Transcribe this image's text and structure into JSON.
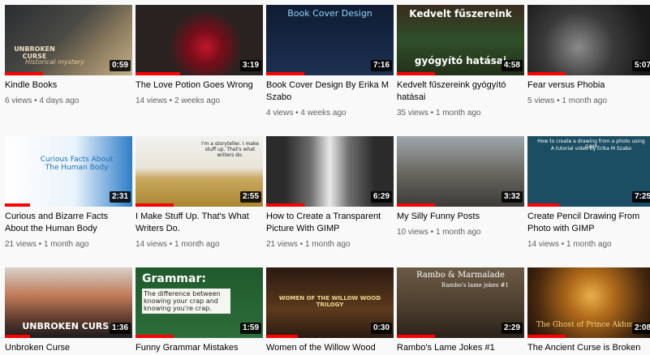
{
  "videos": [
    {
      "title": "Kindle Books",
      "views": "6 views",
      "age": "4 days ago",
      "duration": "0:59",
      "progress": 0.3,
      "caption": "UNBROKEN CURSE",
      "caption2": "Historical mystery"
    },
    {
      "title": "The Love Potion Goes Wrong",
      "views": "14 views",
      "age": "2 weeks ago",
      "duration": "3:19",
      "progress": 0.35
    },
    {
      "title": "Book Cover Design By Erika M Szabo",
      "views": "4 views",
      "age": "4 weeks ago",
      "duration": "7:16",
      "progress": 0.3,
      "caption": "Book Cover Design"
    },
    {
      "title": "Kedvelt fűszereink gyógyító hatásai",
      "views": "35 views",
      "age": "1 month ago",
      "duration": "4:58",
      "progress": 0.3,
      "caption": "Kedvelt fűszereink",
      "caption2": "gyógyító hatásai"
    },
    {
      "title": "Fear versus Phobia",
      "views": "5 views",
      "age": "1 month ago",
      "duration": "5:07",
      "progress": 0.3
    },
    {
      "title": "Curious and Bizarre Facts About the Human Body",
      "views": "21 views",
      "age": "1 month ago",
      "duration": "2:31",
      "progress": 0.2,
      "caption": "Curious Facts About The Human Body"
    },
    {
      "title": "I Make Stuff Up. That's What Writers Do.",
      "views": "14 views",
      "age": "1 month ago",
      "duration": "2:55",
      "progress": 0.3,
      "caption": "I'm a storyteller. I make stuff up. That's what writers do."
    },
    {
      "title": "How to Create a Transparent Picture With GIMP",
      "views": "21 views",
      "age": "1 month ago",
      "duration": "6:29",
      "progress": 0.3
    },
    {
      "title": "My Silly Funny Posts",
      "views": "10 views",
      "age": "1 month ago",
      "duration": "3:32",
      "progress": 0.3
    },
    {
      "title": "Create Pencil Drawing From Photo with GIMP",
      "views": "14 views",
      "age": "1 month ago",
      "duration": "7:25",
      "progress": 0.25,
      "caption": "How to create a drawing from a photo using GIMP",
      "caption2": "A tutorial video by Erika M Szabo"
    },
    {
      "title": "Unbroken Curse",
      "views": "",
      "age": "",
      "duration": "1:36",
      "progress": 0.2,
      "caption": "UNBROKEN CURSE"
    },
    {
      "title": "Funny Grammar Mistakes",
      "views": "",
      "age": "",
      "duration": "1:59",
      "progress": 0.3,
      "caption": "Grammar:",
      "caption2": "The difference between knowing your crap and knowing you're crap."
    },
    {
      "title": "Women of the Willow Wood",
      "views": "",
      "age": "",
      "duration": "0:30",
      "progress": 0.25,
      "caption": "WOMEN OF THE WILLOW WOOD TRILOGY"
    },
    {
      "title": "Rambo's Lame Jokes #1",
      "views": "",
      "age": "",
      "duration": "2:29",
      "progress": 0.3,
      "caption": "Rambo & Marmalade",
      "caption2": "Rambo's lame jokes #1"
    },
    {
      "title": "The Ancient Curse is Broken",
      "views": "",
      "age": "",
      "duration": "2:08",
      "progress": 0.3,
      "caption": "The Ghost of Prince Akhmose"
    }
  ]
}
